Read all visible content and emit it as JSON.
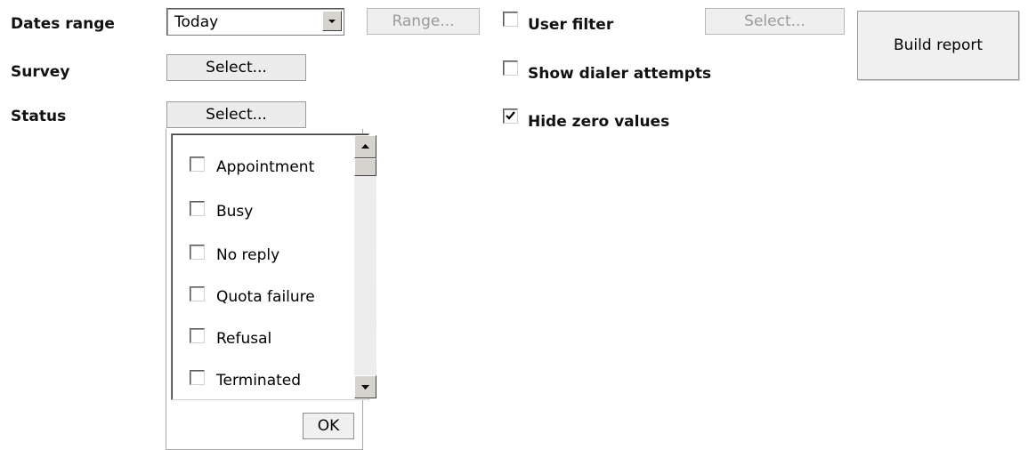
{
  "labels": {
    "dates_range": "Dates range",
    "survey": "Survey",
    "status": "Status"
  },
  "dates_range": {
    "selected": "Today",
    "range_button": "Range..."
  },
  "survey": {
    "select_button": "Select..."
  },
  "status": {
    "select_button": "Select..."
  },
  "user_filter": {
    "label": "User filter",
    "checked": false,
    "select_button": "Select..."
  },
  "show_dialer_attempts": {
    "label": "Show dialer attempts",
    "checked": false
  },
  "hide_zero_values": {
    "label": "Hide zero values",
    "checked": true
  },
  "build_report_button": "Build report",
  "status_popup": {
    "items": [
      {
        "label": "Appointment",
        "checked": false
      },
      {
        "label": "Busy",
        "checked": false
      },
      {
        "label": "No reply",
        "checked": false
      },
      {
        "label": "Quota failure",
        "checked": false
      },
      {
        "label": "Refusal",
        "checked": false
      },
      {
        "label": "Terminated",
        "checked": false
      }
    ],
    "ok_button": "OK"
  }
}
